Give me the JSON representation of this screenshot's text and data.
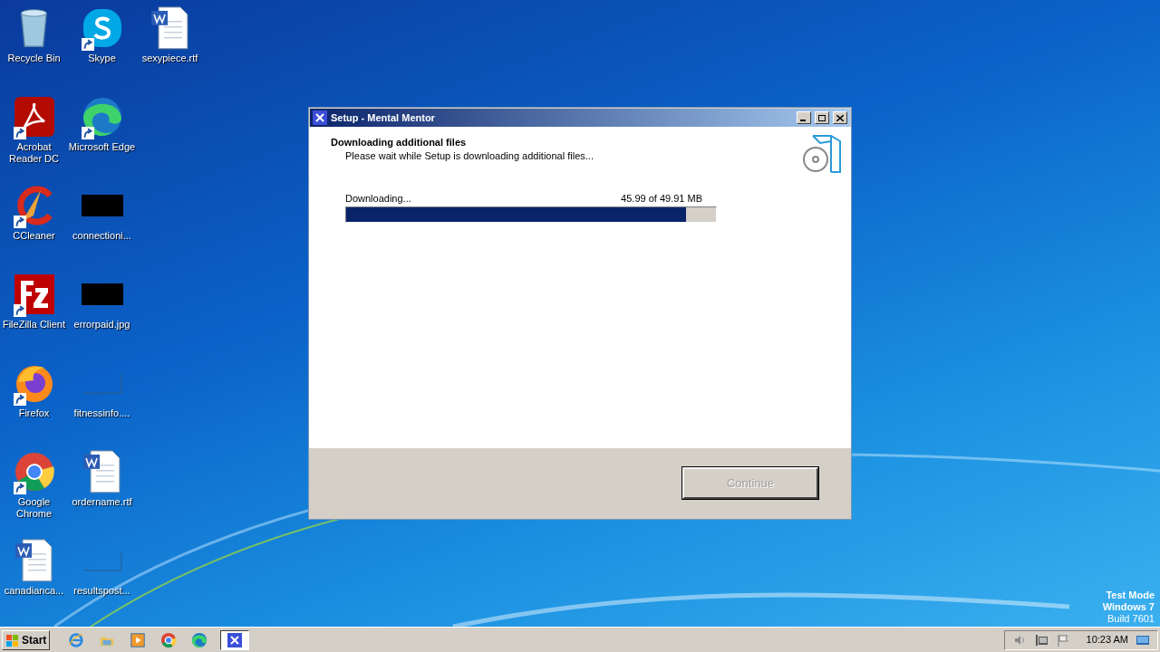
{
  "desktop_icons": [
    {
      "label": "Recycle Bin",
      "kind": "recycle",
      "shortcut": false
    },
    {
      "label": "Acrobat Reader DC",
      "kind": "acrobat",
      "shortcut": true
    },
    {
      "label": "CCleaner",
      "kind": "ccleaner",
      "shortcut": true
    },
    {
      "label": "FileZilla Client",
      "kind": "filezilla",
      "shortcut": true
    },
    {
      "label": "Firefox",
      "kind": "firefox",
      "shortcut": true
    },
    {
      "label": "Google Chrome",
      "kind": "chrome",
      "shortcut": true
    },
    {
      "label": "canadianca...",
      "kind": "word",
      "shortcut": false
    },
    {
      "label": "Skype",
      "kind": "skype",
      "shortcut": true
    },
    {
      "label": "Microsoft Edge",
      "kind": "edge",
      "shortcut": true
    },
    {
      "label": "connectioni...",
      "kind": "thumb",
      "shortcut": false
    },
    {
      "label": "errorpaid.jpg",
      "kind": "thumb",
      "shortcut": false
    },
    {
      "label": "fitnessinfo....",
      "kind": "blank",
      "shortcut": false
    },
    {
      "label": "ordername.rtf",
      "kind": "word",
      "shortcut": false
    },
    {
      "label": "resultspost...",
      "kind": "blank",
      "shortcut": false
    },
    {
      "label": "sexypiece.rtf",
      "kind": "word",
      "shortcut": false
    }
  ],
  "window": {
    "title": "Setup - Mental Mentor",
    "heading": "Downloading additional files",
    "subheading": "Please wait while Setup is downloading additional files...",
    "status": "Downloading...",
    "amount": "45.99 of 49.91 MB",
    "progress": {
      "level": 0.92
    },
    "buttons": [
      {
        "label": "Continue",
        "disabled": true
      }
    ]
  },
  "watermark_text": [
    "Test Mode",
    "Windows 7",
    "Build 7601"
  ],
  "taskbar": {
    "start": "Start",
    "quick_launch": [
      {
        "kind": "ie"
      },
      {
        "kind": "explorer"
      },
      {
        "kind": "media"
      },
      {
        "kind": "chrome"
      },
      {
        "kind": "edge"
      }
    ],
    "tasks": [
      {
        "kind": "setup",
        "selected": true
      }
    ],
    "clock": "10:23 AM"
  }
}
